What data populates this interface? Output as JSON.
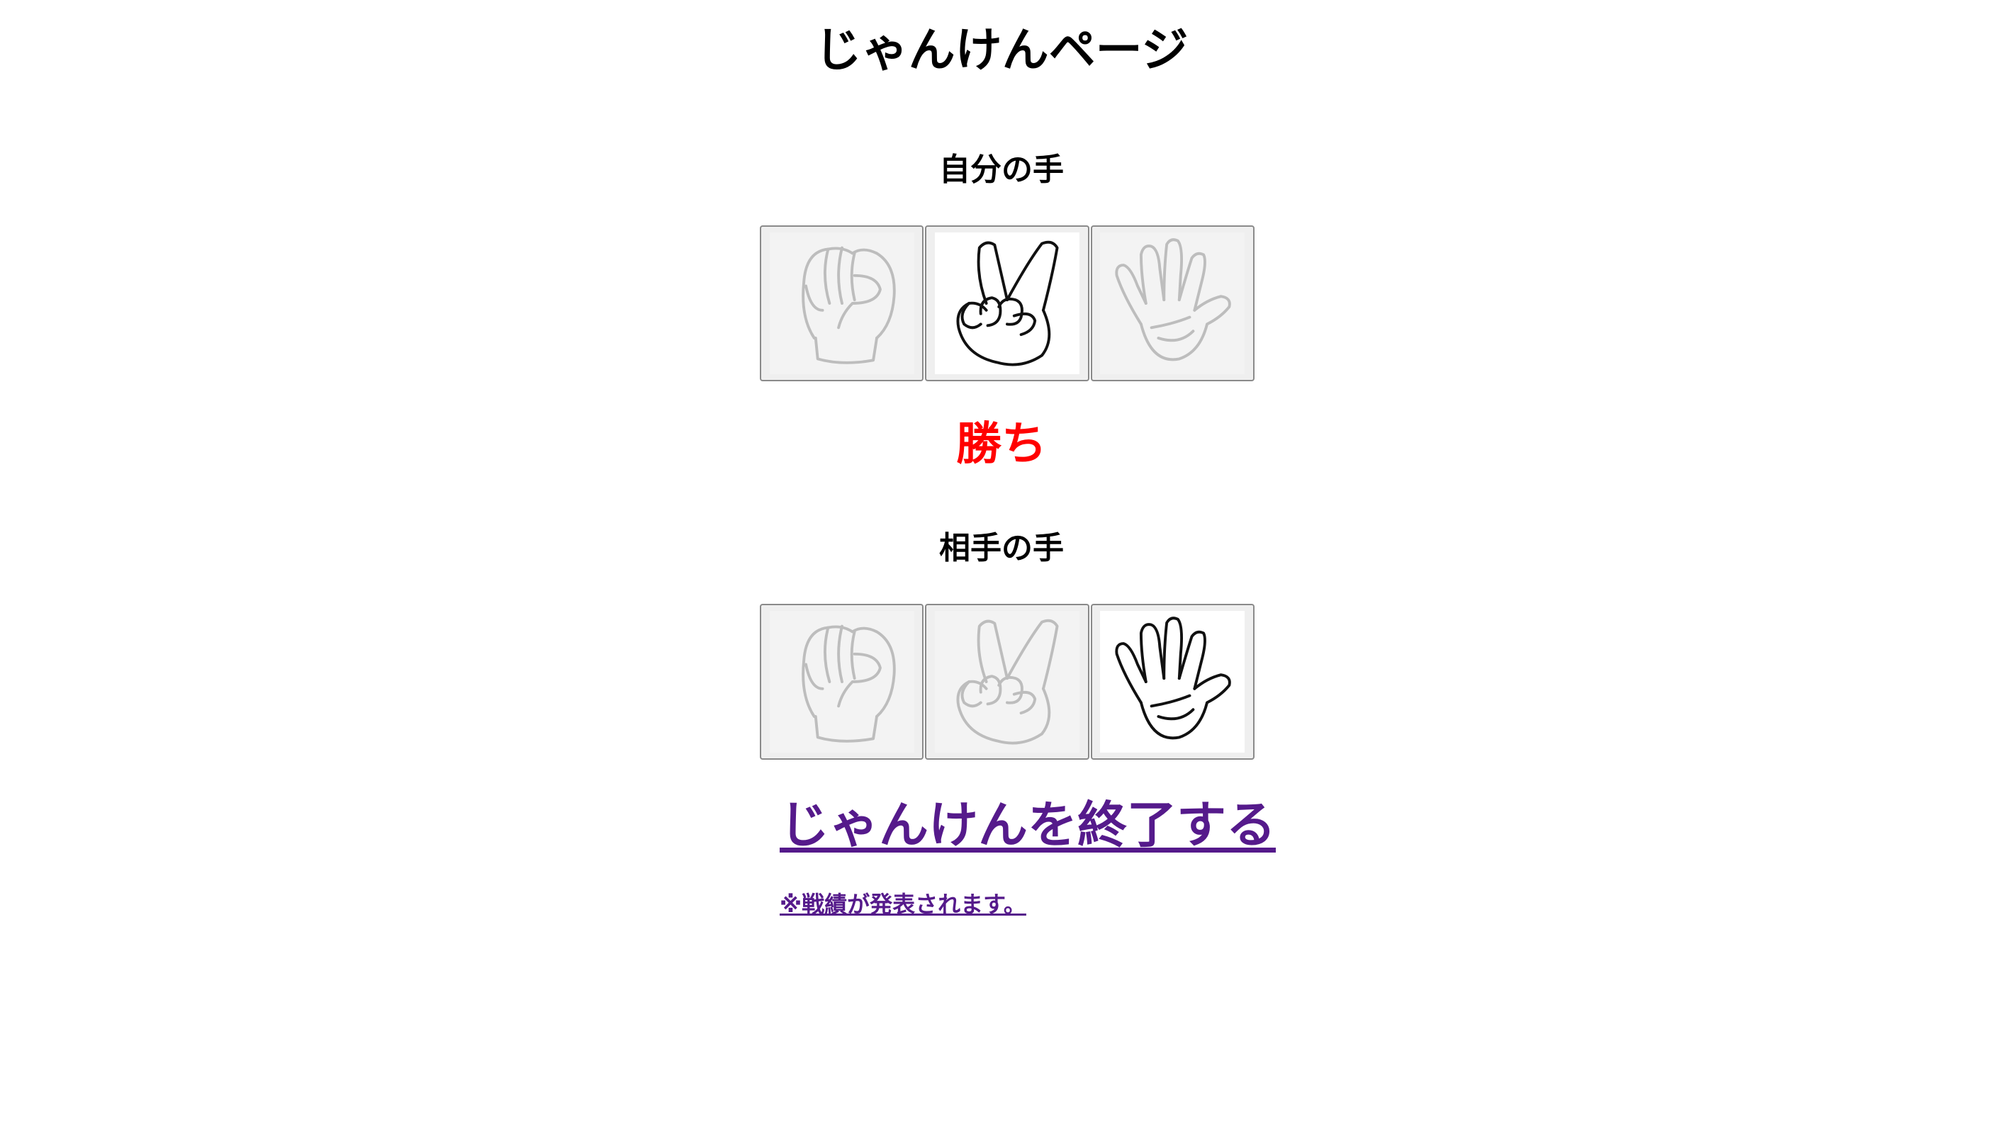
{
  "page": {
    "title": "じゃんけんページ"
  },
  "self": {
    "label": "自分の手",
    "selected": "choki",
    "hands": [
      {
        "id": "gu",
        "icon": "rock-hand-icon",
        "selected": false
      },
      {
        "id": "choki",
        "icon": "scissors-hand-icon",
        "selected": true
      },
      {
        "id": "pa",
        "icon": "paper-hand-icon",
        "selected": false
      }
    ]
  },
  "result": {
    "text": "勝ち",
    "color": "#ff0000"
  },
  "opponent": {
    "label": "相手の手",
    "selected": "pa",
    "hands": [
      {
        "id": "gu",
        "icon": "rock-hand-icon",
        "selected": false
      },
      {
        "id": "choki",
        "icon": "scissors-hand-icon",
        "selected": false
      },
      {
        "id": "pa",
        "icon": "paper-hand-icon",
        "selected": true
      }
    ]
  },
  "links": {
    "end": "じゃんけんを終了する",
    "note": "※戦績が発表されます。",
    "color": "#551a8b"
  }
}
